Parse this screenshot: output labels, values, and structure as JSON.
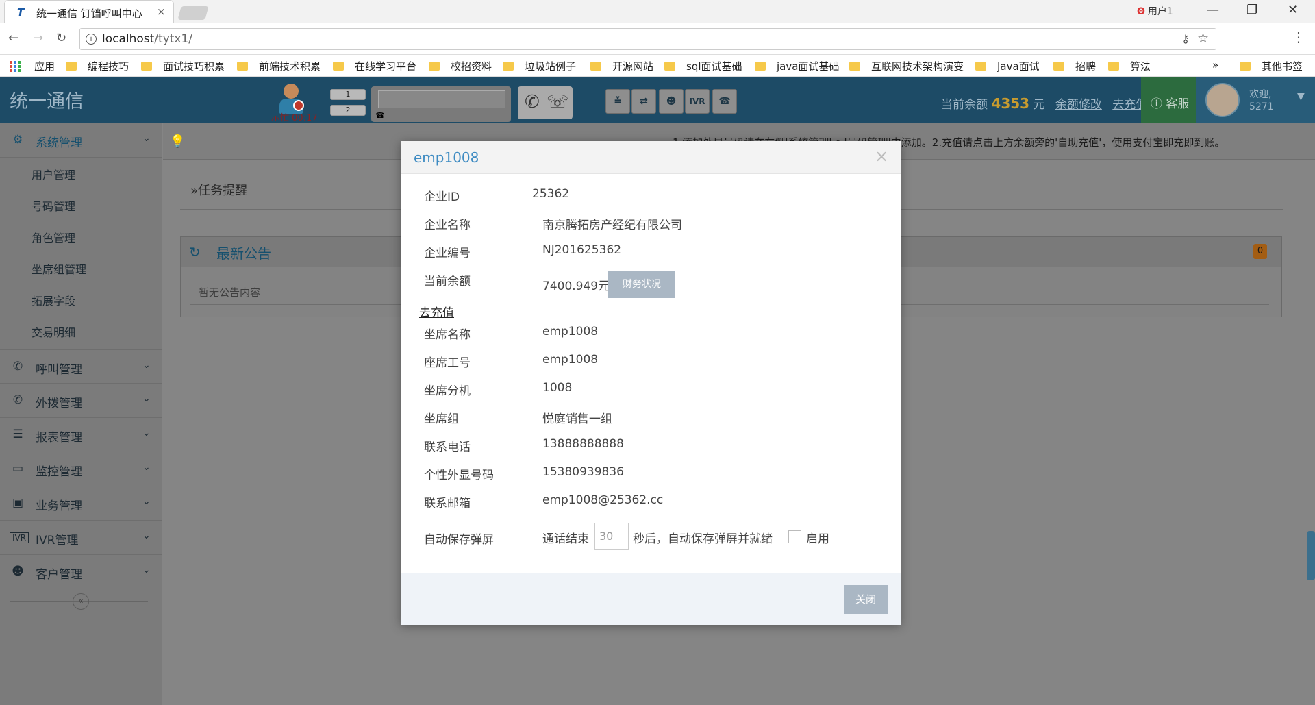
{
  "browser": {
    "tab_title": "统一通信 钉铛呼叫中心",
    "tab_close": "×",
    "user_label": "用户1",
    "url_host": "localhost",
    "url_path": "/tytx1/",
    "bookmarks": [
      "应用",
      "编程技巧",
      "面试技巧积累",
      "前端技术积累",
      "在线学习平台",
      "校招资料",
      "垃圾站例子",
      "开源网站",
      "sql面试基础",
      "java面试基础",
      "互联网技术架构演变",
      "Java面试",
      "招聘",
      "算法"
    ],
    "more": "»",
    "other_bookmarks": "其他书签"
  },
  "header": {
    "brand": "统一通信",
    "agent_status": "示忙 00:17",
    "line1": "1",
    "line2": "2",
    "balance_label": "当前余额",
    "balance_value": "4353",
    "balance_unit": "元",
    "modify_balance": "余额修改",
    "recharge": "去充值",
    "support": "客服",
    "welcome": "欢迎,",
    "user_id": "5271"
  },
  "sidebar": {
    "system": "系统管理",
    "sub_items": [
      "用户管理",
      "号码管理",
      "角色管理",
      "坐席组管理",
      "拓展字段",
      "交易明细"
    ],
    "menus": [
      "呼叫管理",
      "外拨管理",
      "报表管理",
      "监控管理",
      "业务管理",
      "IVR管理",
      "客户管理"
    ],
    "collapse": "«"
  },
  "main": {
    "notice": "1.添加外显号码请在左侧'系统管理'->'号码管理'中添加。2.充值请点击上方余额旁的'自助充值'，使用支付宝即充即到账。",
    "task_reminder": "»任务提醒",
    "announcement_title": "最新公告",
    "announcement_count": "0",
    "announcement_empty": "暂无公告内容"
  },
  "modal": {
    "title": "emp1008",
    "close": "×",
    "rows": [
      {
        "label": "企业ID",
        "value": "25362"
      },
      {
        "label": "企业名称",
        "value": "南京腾拓房产经纪有限公司"
      },
      {
        "label": "企业编号",
        "value": "NJ201625362"
      },
      {
        "label": "当前余额",
        "value": "7400.949元"
      }
    ],
    "finance_button": "财务状况",
    "recharge_link": "去充值",
    "agent_rows": [
      {
        "label": "坐席名称",
        "value": "emp1008"
      },
      {
        "label": "座席工号",
        "value": "emp1008"
      },
      {
        "label": "坐席分机",
        "value": "1008"
      },
      {
        "label": "坐席组",
        "value": "悦庭销售一组"
      },
      {
        "label": "联系电话",
        "value": "13888888888"
      },
      {
        "label": "个性外显号码",
        "value": "15380939836"
      },
      {
        "label": "联系邮箱",
        "value": "emp1008@25362.cc"
      }
    ],
    "autosave_label": "自动保存弹屏",
    "autosave_prefix": "通话结束",
    "autosave_seconds": "30",
    "autosave_suffix": "秒后，自动保存弹屏并就绪",
    "enable_label": "启用",
    "close_button": "关闭"
  }
}
